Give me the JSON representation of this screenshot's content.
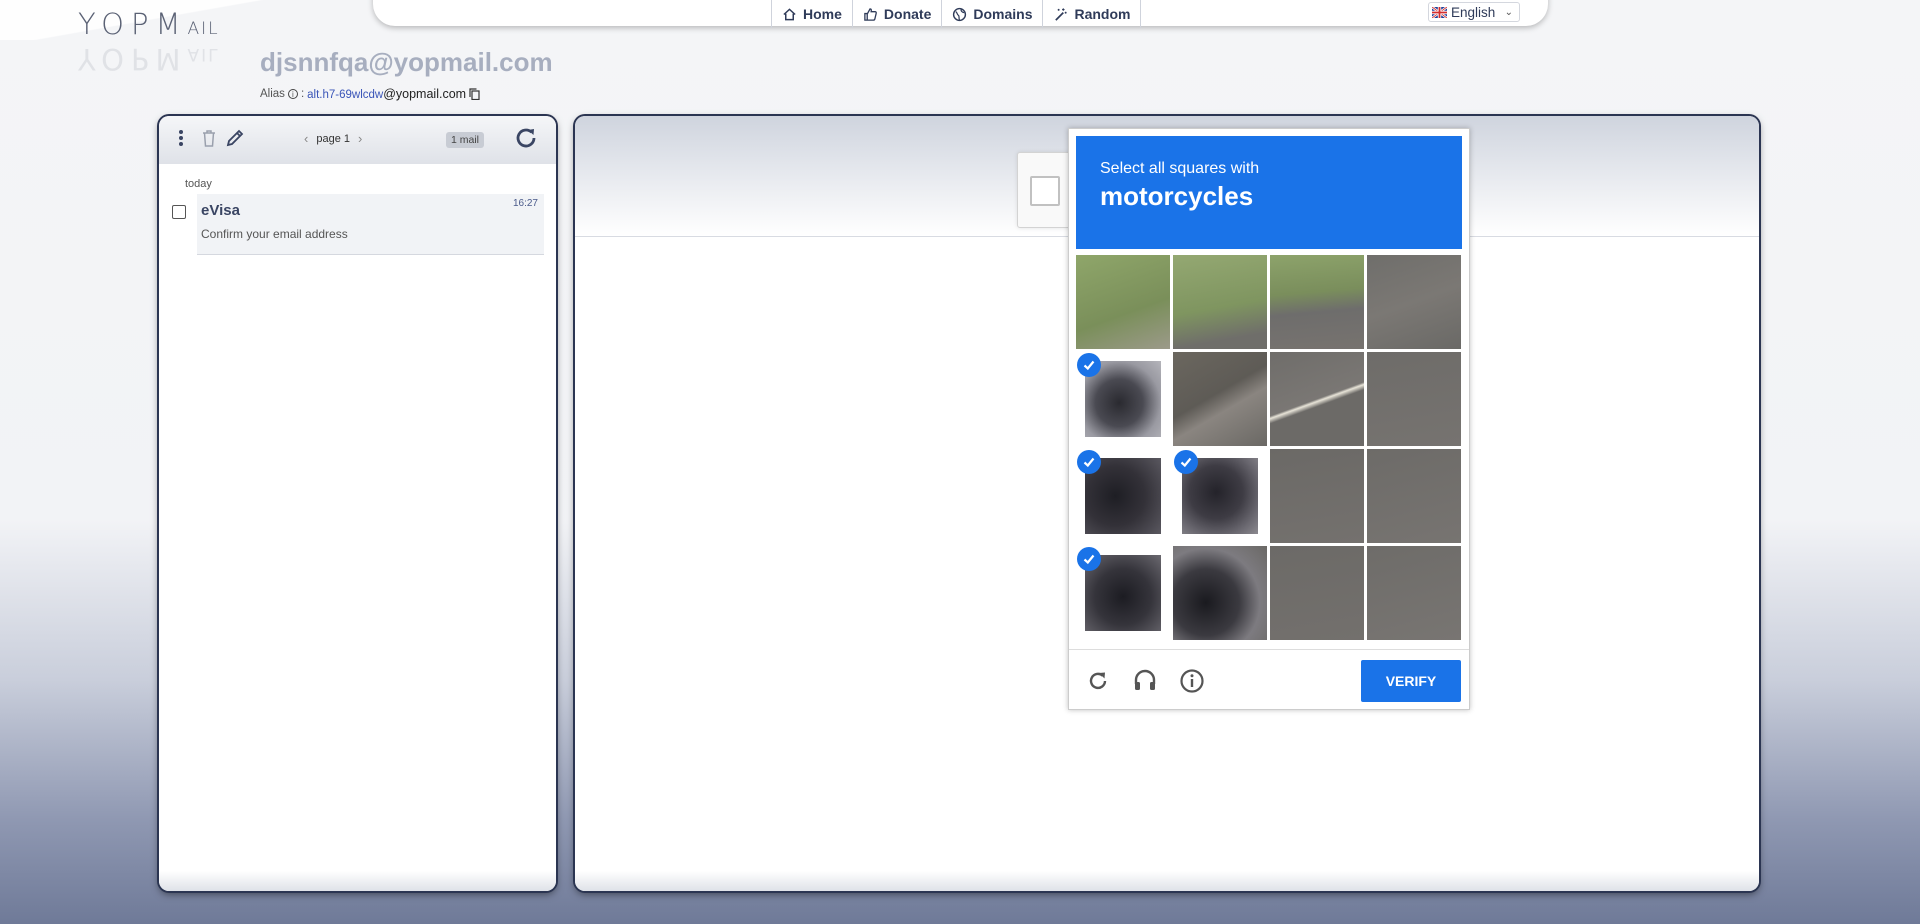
{
  "logo": {
    "main": "YOPM",
    "small": "AIL"
  },
  "nav": {
    "items": [
      {
        "label": "Home",
        "icon": "home-icon"
      },
      {
        "label": "Donate",
        "icon": "thumbs-up-icon"
      },
      {
        "label": "Domains",
        "icon": "globe-icon"
      },
      {
        "label": "Random",
        "icon": "magic-wand-icon"
      }
    ],
    "language": "English"
  },
  "mailbox": {
    "address": "djsnnfqa@yopmail.com",
    "alias_label": "Alias",
    "alias_sep": ":",
    "alias_user": "alt.h7-69wlcdw",
    "alias_domain": "@yopmail.com"
  },
  "inbox": {
    "page_label": "page 1",
    "mail_count": "1 mail",
    "group_label": "today",
    "mails": [
      {
        "from": "eVisa",
        "subject": "Confirm your email address",
        "time": "16:27"
      }
    ]
  },
  "captcha": {
    "instruction_line1": "Select all squares with",
    "instruction_line2": "motorcycles",
    "verify_label": "VERIFY",
    "selected_tiles": [
      4,
      8,
      9,
      12
    ],
    "accent_color": "#1a73e8"
  }
}
